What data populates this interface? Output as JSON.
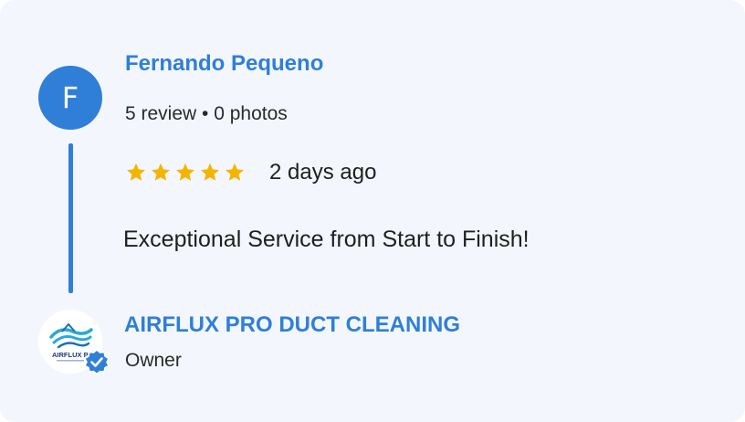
{
  "reviewer": {
    "initial": "F",
    "name": "Fernando Pequeno",
    "meta": "5 review • 0 photos"
  },
  "review": {
    "rating": 5,
    "max_rating": 5,
    "date": "2 days ago",
    "text": "Exceptional Service from Start to Finish!"
  },
  "owner": {
    "logo_text": "AIRFLUX PRO",
    "name": "AIRFLUX PRO DUCT CLEANING",
    "role": "Owner",
    "verified_icon": "verified-check-icon"
  },
  "colors": {
    "accent": "#2f7fd8",
    "star": "#f5b400",
    "background": "#f3f7fd"
  }
}
